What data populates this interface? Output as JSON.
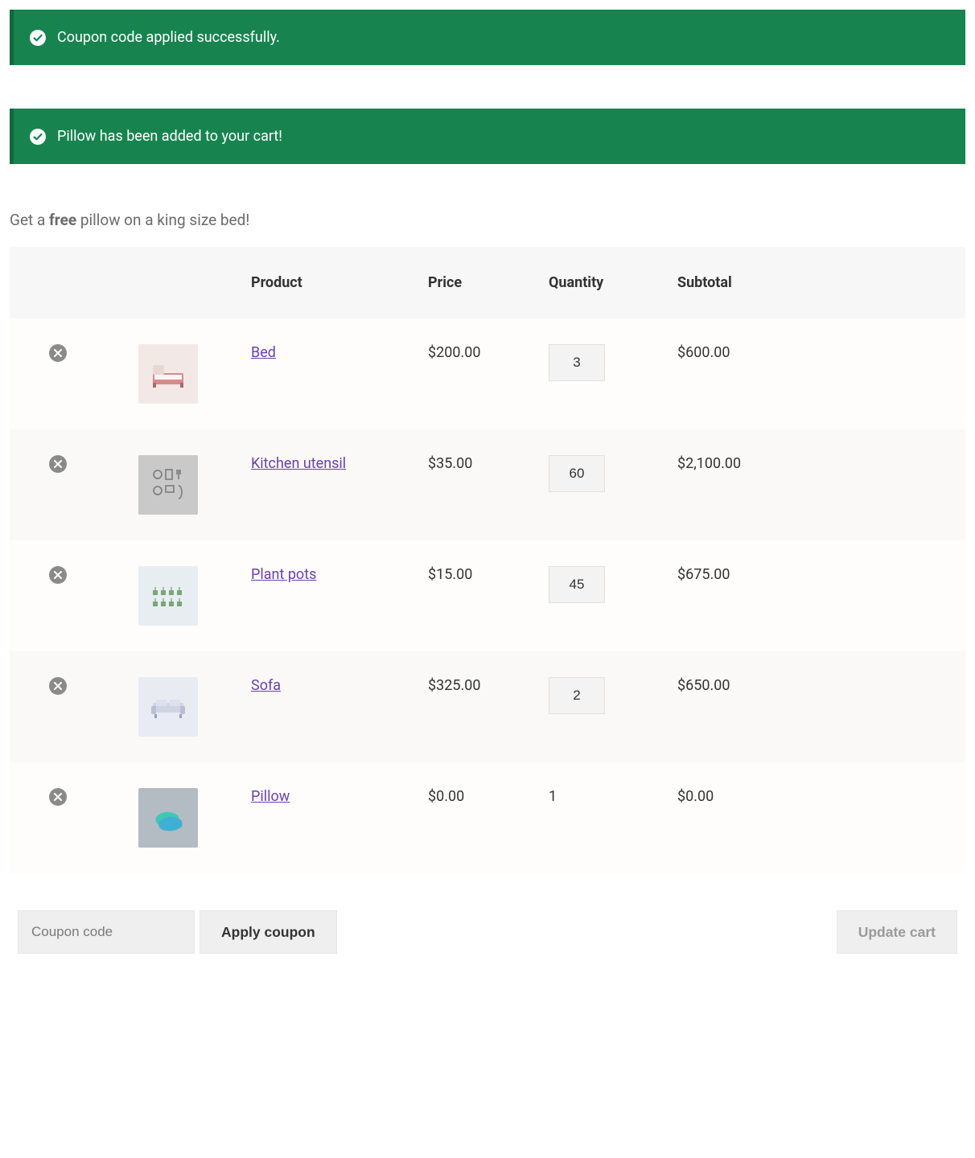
{
  "notices": [
    {
      "message": "Coupon code applied successfully."
    },
    {
      "message": "Pillow has been added to your cart!"
    }
  ],
  "promo": {
    "prefix": "Get a ",
    "strong": "free",
    "suffix": " pillow on a king size bed!"
  },
  "headers": {
    "product": "Product",
    "price": "Price",
    "quantity": "Quantity",
    "subtotal": "Subtotal"
  },
  "items": [
    {
      "name": "Bed",
      "price": "$200.00",
      "qty": "3",
      "subtotal": "$600.00",
      "qty_editable": true,
      "thumb_bg": "#f2e9e7",
      "icon": "bed"
    },
    {
      "name": "Kitchen utensil",
      "price": "$35.00",
      "qty": "60",
      "subtotal": "$2,100.00",
      "qty_editable": true,
      "thumb_bg": "#c9c9c9",
      "icon": "utensils"
    },
    {
      "name": "Plant pots",
      "price": "$15.00",
      "qty": "45",
      "subtotal": "$675.00",
      "qty_editable": true,
      "thumb_bg": "#e7edf0",
      "icon": "plants"
    },
    {
      "name": "Sofa",
      "price": "$325.00",
      "qty": "2",
      "subtotal": "$650.00",
      "qty_editable": true,
      "thumb_bg": "#e8ebf2",
      "icon": "sofa"
    },
    {
      "name": "Pillow",
      "price": "$0.00",
      "qty": "1",
      "subtotal": "$0.00",
      "qty_editable": false,
      "thumb_bg": "#b3bcc2",
      "icon": "pillow"
    }
  ],
  "coupon": {
    "placeholder": "Coupon code",
    "apply_label": "Apply coupon"
  },
  "update_label": "Update cart"
}
